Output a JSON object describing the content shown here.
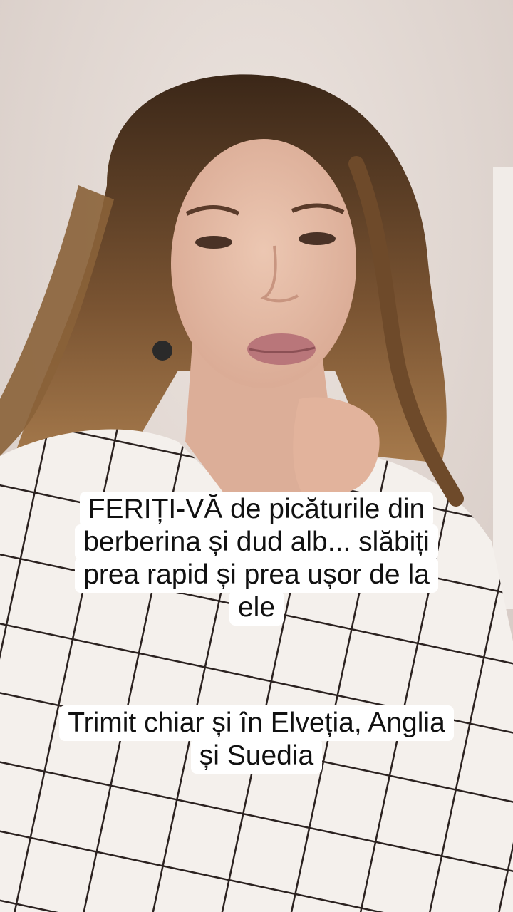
{
  "video": {
    "background_colors": {
      "wall": "#e0d6d0",
      "hair": "#6b4a2e",
      "shirt": "#f5f2ee",
      "stripes": "#2b2220"
    },
    "caption_blocks": [
      {
        "lines": [
          "FERIȚI-VĂ de picăturile din",
          "berberina și dud alb... slăbiți",
          "prea rapid și prea ușor de la",
          "ele"
        ]
      },
      {
        "lines": [
          "Trimit chiar și în Elveția, Anglia",
          "și Suedia"
        ]
      }
    ]
  }
}
